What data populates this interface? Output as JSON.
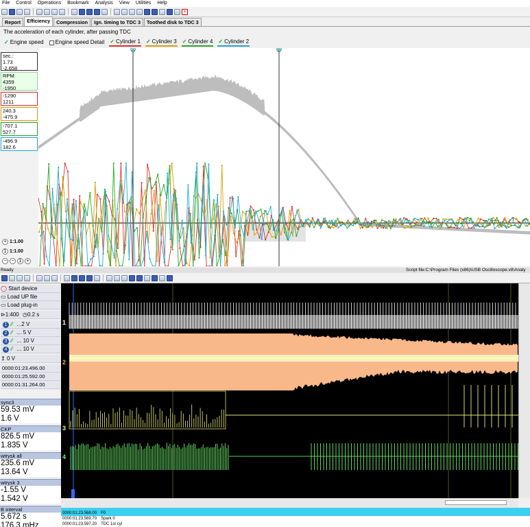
{
  "menu": [
    "File",
    "Control",
    "Operations",
    "Bookmark",
    "Analysis",
    "View",
    "Utilities",
    "Help"
  ],
  "tabs": [
    {
      "label": "Report",
      "active": false
    },
    {
      "label": "Efficiency",
      "active": true
    },
    {
      "label": "Compression",
      "active": false
    },
    {
      "label": "Ign. timing to TDC 3",
      "active": false
    },
    {
      "label": "Toothed disk to TDC 3",
      "active": false
    }
  ],
  "subtitle": "The acceleration of each cylinder, after passing TDC",
  "legend": [
    {
      "label": "Engine speed",
      "checked": true,
      "color": "#9a9a9a"
    },
    {
      "label": "Engine speed Detail",
      "checked": false,
      "color": "#888888"
    },
    {
      "label": "Cylinder 1",
      "checked": true,
      "color": "#e03030"
    },
    {
      "label": "Cylinder 3",
      "checked": true,
      "color": "#d9a000"
    },
    {
      "label": "Cylinder 4",
      "checked": true,
      "color": "#28a828"
    },
    {
      "label": "Cylinder 2",
      "checked": true,
      "color": "#20a8d8"
    }
  ],
  "cursors": {
    "a": "A",
    "b": "B"
  },
  "values": [
    {
      "l1": "sec.:",
      "l2": "1.73",
      "l3": "-2.658",
      "border": "#333333"
    },
    {
      "l1": "RPM:",
      "l2": "4359",
      "l3": "-1950",
      "border": "#9fd59f"
    },
    {
      "l1": "",
      "l2": "-1290",
      "l3": "1211",
      "border": "#e03030"
    },
    {
      "l1": "",
      "l2": "240.3",
      "l3": "-475.9",
      "border": "#d9a000"
    },
    {
      "l1": "",
      "l2": "-707.1",
      "l3": "527.7",
      "border": "#28a828"
    },
    {
      "l1": "",
      "l2": "-496.9",
      "l3": "182.6",
      "border": "#20a8d8"
    }
  ],
  "zoom": {
    "y": "1:1.00",
    "x": "1:1.00"
  },
  "status_ready": "Ready",
  "status_script": "Script file:C:\\Program Files (x86)\\USB Oscilloscope.v8\\Analy",
  "scope_controls": {
    "start": "Start device",
    "load_file": "Load UP file",
    "load_plugin": "Load plug-in",
    "timebase": "1:400",
    "timediv": "0.2 s",
    "channels": [
      {
        "num": "1",
        "val": "...2 V",
        "color": "#ffffff"
      },
      {
        "num": "2",
        "val": "... 5 V",
        "color": "#ffa060"
      },
      {
        "num": "3",
        "val": "... 10 V",
        "color": "#e8e870"
      },
      {
        "num": "4",
        "val": "... 10 V",
        "color": "#60e060"
      }
    ],
    "trigger": "0 V",
    "times": [
      "0000:01:23.496.00",
      "0000:01:25.592.00",
      "0000:01:31.264.00"
    ]
  },
  "measurements": [
    {
      "name": "sync3",
      "v1": "59.53 mV",
      "v2": "1.6 V"
    },
    {
      "name": "CKP",
      "v1": "826.5 mV",
      "v2": "1.835 V"
    },
    {
      "name": "wtrysk all",
      "v1": "235.6 mV",
      "v2": "13.64 V"
    },
    {
      "name": "wtrysk 3",
      "v1": "-1.55 V",
      "v2": "1.542 V"
    },
    {
      "name": "B interval",
      "v1": "5.672 s",
      "v2": "176.3 mHz"
    }
  ],
  "channel_labels": [
    "1",
    "2",
    "3",
    "4"
  ],
  "events": [
    {
      "time": "0000:01:23.568.00",
      "name": "F0"
    },
    {
      "time": "0000:01:23.569.70",
      "name": "Spark 0"
    },
    {
      "time": "0000:01:23.597.20",
      "name": "TDC 1st cyl"
    }
  ]
}
